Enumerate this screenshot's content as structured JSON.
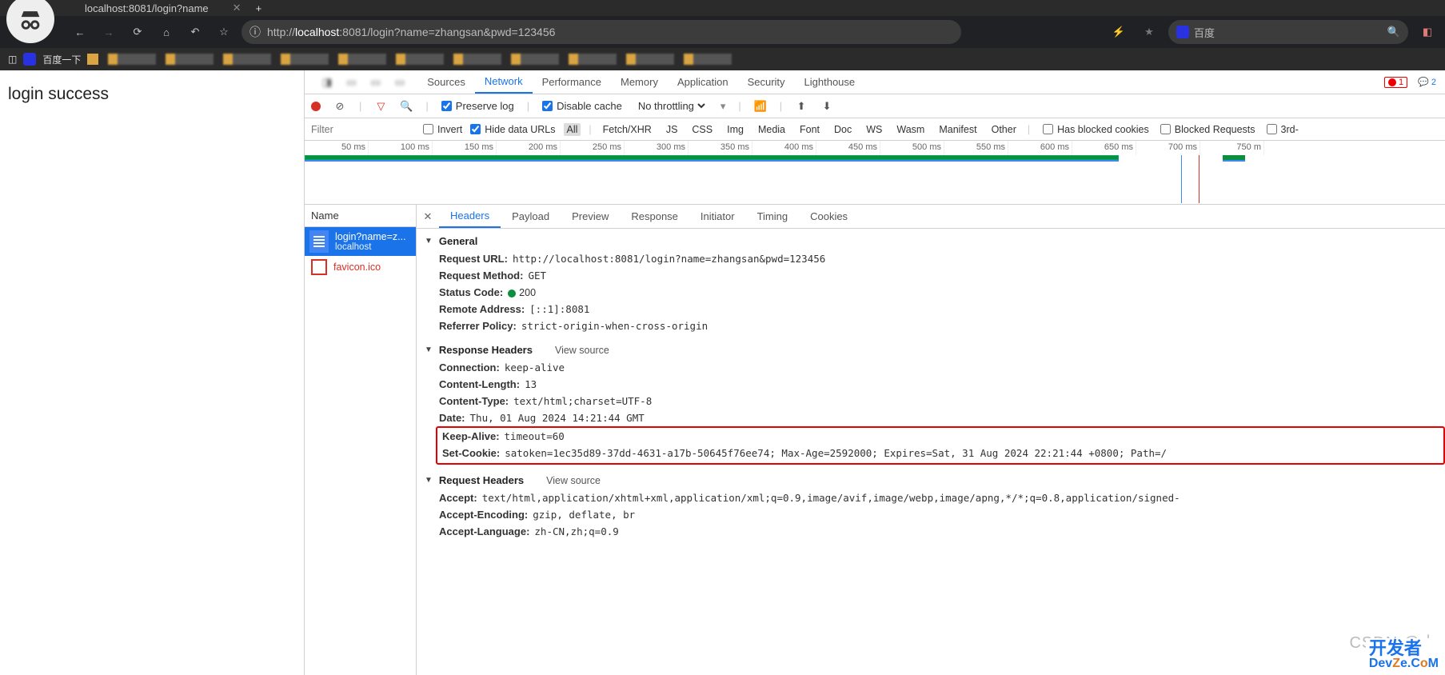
{
  "browser": {
    "tab_fragment": "localhost:8081/login?name",
    "url_proto": "http://",
    "url_host": "localhost",
    "url_port_path": ":8081/login?name=zhangsan&pwd=123456",
    "search_placeholder": "百度",
    "bookmark_label": "百度一下"
  },
  "page": {
    "body_text": "login success"
  },
  "devtools": {
    "tabs": {
      "sources": "Sources",
      "network": "Network",
      "performance": "Performance",
      "memory": "Memory",
      "application": "Application",
      "security": "Security",
      "lighthouse": "Lighthouse"
    },
    "badges": {
      "errors": "1",
      "chat": "2"
    },
    "toolbar": {
      "preserve": "Preserve log",
      "disable_cache": "Disable cache",
      "throttling": "No throttling"
    },
    "filter": {
      "placeholder": "Filter",
      "invert": "Invert",
      "hide_data": "Hide data URLs",
      "types": [
        "All",
        "Fetch/XHR",
        "JS",
        "CSS",
        "Img",
        "Media",
        "Font",
        "Doc",
        "WS",
        "Wasm",
        "Manifest",
        "Other"
      ],
      "blocked_cookies": "Has blocked cookies",
      "blocked_requests": "Blocked Requests",
      "third_party": "3rd-"
    },
    "timeline_ticks": [
      "50 ms",
      "100 ms",
      "150 ms",
      "200 ms",
      "250 ms",
      "300 ms",
      "350 ms",
      "400 ms",
      "450 ms",
      "500 ms",
      "550 ms",
      "600 ms",
      "650 ms",
      "700 ms",
      "750 m"
    ],
    "name_header": "Name",
    "requests": {
      "r0_name": "login?name=z...",
      "r0_host": "localhost",
      "r1_name": "favicon.ico"
    },
    "detail_tabs": {
      "headers": "Headers",
      "payload": "Payload",
      "preview": "Preview",
      "response": "Response",
      "initiator": "Initiator",
      "timing": "Timing",
      "cookies": "Cookies"
    },
    "general": {
      "title": "General",
      "request_url_k": "Request URL:",
      "request_url_v": "http://localhost:8081/login?name=zhangsan&pwd=123456",
      "request_method_k": "Request Method:",
      "request_method_v": "GET",
      "status_code_k": "Status Code:",
      "status_code_v": "200",
      "remote_addr_k": "Remote Address:",
      "remote_addr_v": "[::1]:8081",
      "referrer_k": "Referrer Policy:",
      "referrer_v": "strict-origin-when-cross-origin"
    },
    "response_headers": {
      "title": "Response Headers",
      "view_source": "View source",
      "connection_k": "Connection:",
      "connection_v": "keep-alive",
      "content_length_k": "Content-Length:",
      "content_length_v": "13",
      "content_type_k": "Content-Type:",
      "content_type_v": "text/html;charset=UTF-8",
      "date_k": "Date:",
      "date_v": "Thu, 01 Aug 2024 14:21:44 GMT",
      "keep_alive_k": "Keep-Alive:",
      "keep_alive_v": "timeout=60",
      "set_cookie_k": "Set-Cookie:",
      "set_cookie_v": "satoken=1ec35d89-37dd-4631-a17b-50645f76ee74; Max-Age=2592000; Expires=Sat, 31 Aug 2024 22:21:44 +0800; Path=/"
    },
    "request_headers": {
      "title": "Request Headers",
      "view_source": "View source",
      "accept_k": "Accept:",
      "accept_v": "text/html,application/xhtml+xml,application/xml;q=0.9,image/avif,image/webp,image/apng,*/*;q=0.8,application/signed-",
      "accept_enc_k": "Accept-Encoding:",
      "accept_enc_v": "gzip, deflate, br",
      "accept_lang_k": "Accept-Language:",
      "accept_lang_v": "zh-CN,zh;q=0.9"
    }
  },
  "watermark": "CSDN @小",
  "devze_top": "开发者",
  "devze_bot": "DevZe.CoM"
}
